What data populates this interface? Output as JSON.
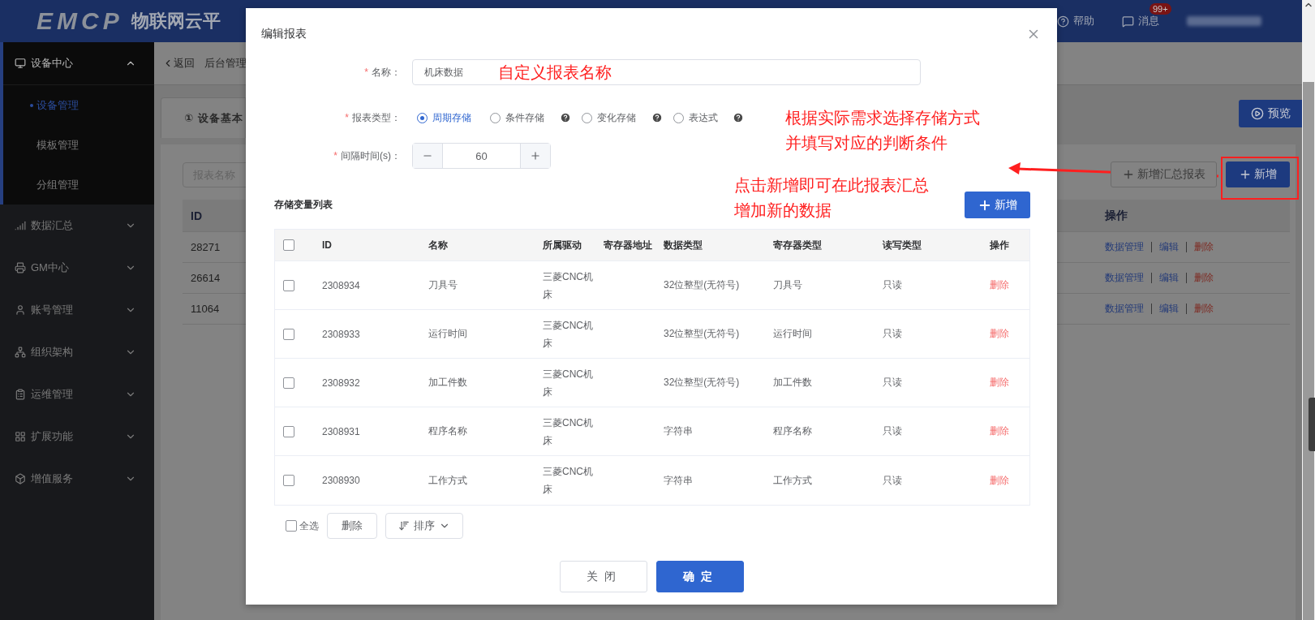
{
  "header": {
    "logo": "EMCP",
    "title": "物联网云平",
    "help": "帮助",
    "messages": "消息",
    "message_badge": "99+"
  },
  "sidebar": {
    "items": [
      {
        "label": "设备中心",
        "expanded": true,
        "children": [
          {
            "label": "设备管理",
            "selected": true
          },
          {
            "label": "模板管理",
            "selected": false
          },
          {
            "label": "分组管理",
            "selected": false
          }
        ]
      },
      {
        "label": "数据汇总",
        "expanded": false
      },
      {
        "label": "GM中心",
        "expanded": false
      },
      {
        "label": "账号管理",
        "expanded": false
      },
      {
        "label": "组织架构",
        "expanded": false
      },
      {
        "label": "运维管理",
        "expanded": false
      },
      {
        "label": "扩展功能",
        "expanded": false
      },
      {
        "label": "增值服务",
        "expanded": false
      }
    ]
  },
  "breadcrumb": {
    "back": "返回",
    "current": "后台管理"
  },
  "step_tab": {
    "label": "① 设备基本"
  },
  "preview_button": "预览",
  "search": {
    "placeholder": "报表名称"
  },
  "toolbar": {
    "add_summary": "新增汇总报表",
    "add": "新增"
  },
  "report_table": {
    "columns": [
      "ID",
      "操作"
    ],
    "rows": [
      {
        "id": "28271",
        "actions": [
          {
            "label": "数据管理",
            "kind": "link"
          },
          {
            "label": "编辑",
            "kind": "link"
          },
          {
            "label": "删除",
            "kind": "danger"
          }
        ]
      },
      {
        "id": "26614",
        "actions": [
          {
            "label": "数据管理",
            "kind": "link"
          },
          {
            "label": "编辑",
            "kind": "link"
          },
          {
            "label": "删除",
            "kind": "danger"
          }
        ]
      },
      {
        "id": "11064",
        "actions": [
          {
            "label": "数据管理",
            "kind": "link"
          },
          {
            "label": "编辑",
            "kind": "link"
          },
          {
            "label": "删除",
            "kind": "danger"
          }
        ]
      }
    ]
  },
  "dialog": {
    "title": "编辑报表",
    "name_field": {
      "mark": "*",
      "label": "名称：",
      "value": "机床数据"
    },
    "type_field": {
      "mark": "*",
      "label": "报表类型：",
      "options": [
        {
          "label": "周期存储",
          "selected": true,
          "help": false
        },
        {
          "label": "条件存储",
          "selected": false,
          "help": true
        },
        {
          "label": "变化存储",
          "selected": false,
          "help": true
        },
        {
          "label": "表达式",
          "selected": false,
          "help": true
        }
      ]
    },
    "interval_field": {
      "mark": "*",
      "label": "间隔时间(s)：",
      "value": "60"
    },
    "list_title": "存储变量列表",
    "add_button": "新增",
    "table": {
      "header_checked": false,
      "columns": [
        "ID",
        "名称",
        "所属驱动",
        "寄存器地址",
        "数据类型",
        "寄存器类型",
        "读写类型",
        "操作"
      ],
      "rows": [
        {
          "checked": false,
          "id": "2308934",
          "name": "刀具号",
          "driver": "三菱CNC机床",
          "data_type": "32位整型(无符号)",
          "register_type": "刀具号",
          "access": "只读",
          "action": "删除"
        },
        {
          "checked": false,
          "id": "2308933",
          "name": "运行时间",
          "driver": "三菱CNC机床",
          "data_type": "32位整型(无符号)",
          "register_type": "运行时间",
          "access": "只读",
          "action": "删除"
        },
        {
          "checked": false,
          "id": "2308932",
          "name": "加工件数",
          "driver": "三菱CNC机床",
          "data_type": "32位整型(无符号)",
          "register_type": "加工件数",
          "access": "只读",
          "action": "删除"
        },
        {
          "checked": false,
          "id": "2308931",
          "name": "程序名称",
          "driver": "三菱CNC机床",
          "data_type": "字符串",
          "register_type": "程序名称",
          "access": "只读",
          "action": "删除"
        },
        {
          "checked": false,
          "id": "2308930",
          "name": "工作方式",
          "driver": "三菱CNC机床",
          "data_type": "字符串",
          "register_type": "工作方式",
          "access": "只读",
          "action": "删除"
        }
      ]
    },
    "select_all": {
      "label": "全选",
      "checked": false
    },
    "delete_button": "删除",
    "sort_button": "排序",
    "close_button": "关闭",
    "confirm_button": "确定"
  },
  "annotations": [
    {
      "lines": [
        "自定义报表名称"
      ]
    },
    {
      "lines": [
        "根据实际需求选择存储方式",
        "并填写对应的判断条件"
      ]
    },
    {
      "lines": [
        "点击新增即可在此报表汇总",
        "增加新的数据"
      ]
    }
  ]
}
